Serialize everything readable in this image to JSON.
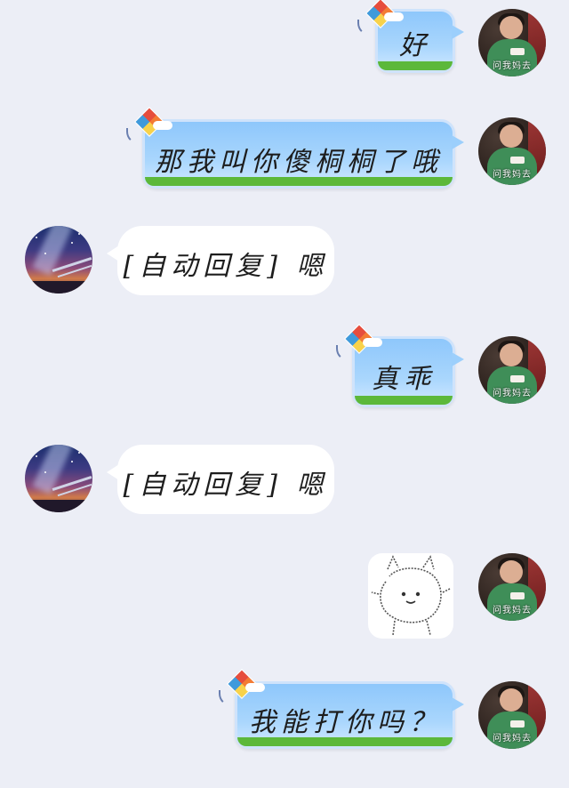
{
  "chat": {
    "messages": [
      {
        "sender": "me",
        "type": "text",
        "text": "好"
      },
      {
        "sender": "me",
        "type": "text",
        "text": "那我叫你傻桐桐了哦"
      },
      {
        "sender": "other",
        "type": "text",
        "text": "[自动回复] 嗯"
      },
      {
        "sender": "me",
        "type": "text",
        "text": "真乖"
      },
      {
        "sender": "other",
        "type": "text",
        "text": "[自动回复] 嗯"
      },
      {
        "sender": "me",
        "type": "sticker",
        "sticker": "doodle-cat-sticker"
      },
      {
        "sender": "me",
        "type": "text",
        "text": "我能打你吗？"
      }
    ],
    "my_avatar_watermark": "问我妈去"
  },
  "colors": {
    "background": "#eceef6",
    "sky_bubble": "#9ccffc",
    "grass": "#5cb83a",
    "white_bubble": "#ffffff"
  }
}
